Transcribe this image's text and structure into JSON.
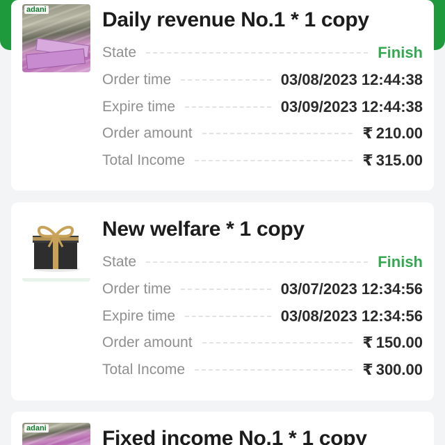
{
  "orders": [
    {
      "image_brand": "adani",
      "title": "Daily revenue No.1 * 1 copy",
      "state_label": "State",
      "state_value": "Finish",
      "order_time_label": "Order time",
      "order_time_value": "03/08/2023 12:44:38",
      "expire_time_label": "Expire time",
      "expire_time_value": "03/09/2023 12:44:38",
      "order_amount_label": "Order amount",
      "order_amount_value": "210.00",
      "total_income_label": "Total Income",
      "total_income_value": "315.00"
    },
    {
      "title": "New welfare * 1 copy",
      "state_label": "State",
      "state_value": "Finish",
      "order_time_label": "Order time",
      "order_time_value": "03/07/2023 12:34:56",
      "expire_time_label": "Expire time",
      "expire_time_value": "03/08/2023 12:34:56",
      "order_amount_label": "Order amount",
      "order_amount_value": "150.00",
      "total_income_label": "Total Income",
      "total_income_value": "300.00"
    },
    {
      "image_brand": "adani",
      "title": "Fixed income No.1 * 1 copy"
    }
  ],
  "currency_symbol": "₹",
  "colors": {
    "header_green": "#1e9a3c",
    "finish_green": "#35a852"
  }
}
